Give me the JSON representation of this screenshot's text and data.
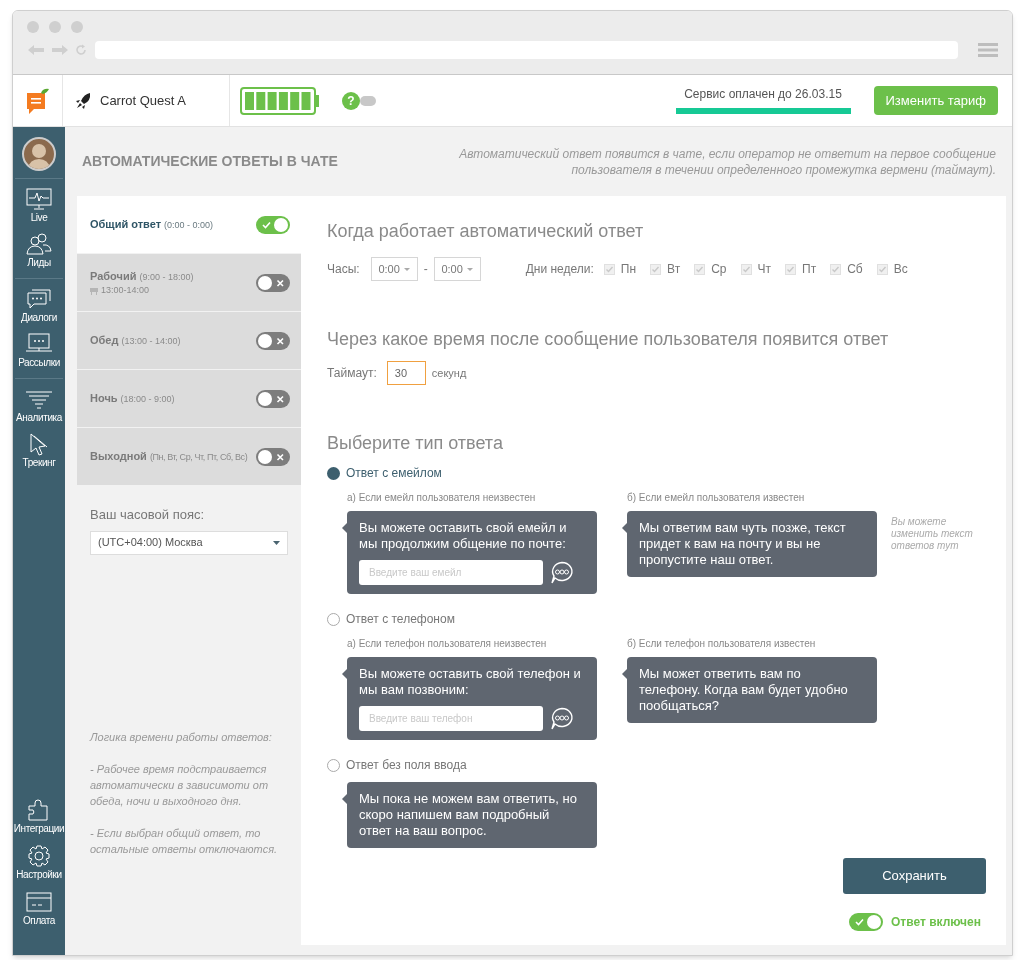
{
  "header": {
    "project": "Carrot Quest A",
    "help": "?",
    "switch_on": false,
    "payment": {
      "text": "Сервис оплачен до 26.03.15"
    },
    "upgrade_button": "Изменить тариф"
  },
  "sidebar": {
    "groups": [
      [
        {
          "label": "Live"
        },
        {
          "label": "Лиды"
        }
      ],
      [
        {
          "label": "Диалоги"
        },
        {
          "label": "Рассылки"
        }
      ],
      [
        {
          "label": "Аналитика"
        },
        {
          "label": "Трекинг"
        }
      ]
    ],
    "bottom": [
      {
        "label": "Интеграции"
      },
      {
        "label": "Настройки"
      },
      {
        "label": "Оплата"
      }
    ]
  },
  "page": {
    "title": "АВТОМАТИЧЕСКИЕ ОТВЕТЫ В ЧАТЕ",
    "description": "Автоматический ответ появится в чате, если оператор не ответит на первое сообщение пользователя в течении определенного промежутка вермени (таймаут)."
  },
  "schedules": [
    {
      "name": "Общий ответ",
      "hours": "(0:00 - 0:00)",
      "selected": true,
      "on": true
    },
    {
      "name": "Рабочий",
      "hours": "(9:00 - 18:00)",
      "note": "13:00-14:00",
      "selected": false,
      "on": false
    },
    {
      "name": "Обед",
      "hours": "(13:00 - 14:00)",
      "selected": false,
      "on": false
    },
    {
      "name": "Ночь",
      "hours": "(18:00 - 9:00)",
      "selected": false,
      "on": false
    },
    {
      "name": "Выходной",
      "hours": "(Пн, Вт, Ср, Чт, Пт, Сб, Вс)",
      "selected": false,
      "on": false
    }
  ],
  "timezone": {
    "label": "Ваш часовой пояс:",
    "value": "(UTC+04:00) Москва"
  },
  "logic_note": [
    "Логика времени работы ответов:",
    "- Рабочее время подстраивается автоматически в зависимоти от обеда, ночи и выходного дня.",
    "- Если выбран общий ответ, то остальные ответы отключаются."
  ],
  "when": {
    "title": "Когда работает автоматический ответ",
    "hours_label": "Часы:",
    "from": "0:00",
    "separator": "-",
    "to": "0:00",
    "days_label": "Дни недели:",
    "days": [
      {
        "label": "Пн",
        "checked": true
      },
      {
        "label": "Вт",
        "checked": true
      },
      {
        "label": "Ср",
        "checked": true
      },
      {
        "label": "Чт",
        "checked": true
      },
      {
        "label": "Пт",
        "checked": true
      },
      {
        "label": "Сб",
        "checked": true
      },
      {
        "label": "Вс",
        "checked": true
      }
    ]
  },
  "timeout": {
    "title": "Через какое время после сообщение пользователя появится ответ",
    "label": "Таймаут:",
    "value": "30",
    "unit": "секунд"
  },
  "reply_type": {
    "title": "Выберите тип ответа",
    "side_note": "Вы можете изменить текст ответов тут",
    "options": [
      {
        "label": "Ответ с емейлом",
        "selected": true,
        "cases": [
          {
            "caption": "а) Если емейл пользователя неизвестен",
            "message": "Вы можете оставить свой емейл и мы продолжим общение по почте:",
            "placeholder": "Введите ваш емейл"
          },
          {
            "caption": "б) Если емейл пользователя известен",
            "message": "Мы ответим вам чуть позже, текст придет к вам на почту и вы не пропустите наш ответ."
          }
        ]
      },
      {
        "label": "Ответ с телефоном",
        "selected": false,
        "cases": [
          {
            "caption": "а) Если телефон пользователя неизвестен",
            "message": "Вы можете оставить свой телефон и мы вам позвоним:",
            "placeholder": "Введите ваш телефон"
          },
          {
            "caption": "б) Если телефон пользователя известен",
            "message": "Мы может ответить вам по телефону. Когда вам будет удобно пообщаться?"
          }
        ]
      },
      {
        "label": "Ответ без поля ввода",
        "selected": false,
        "cases": [
          {
            "message": "Мы пока не можем вам ответить, но скоро напишем вам подробный ответ на ваш вопрос."
          }
        ]
      }
    ]
  },
  "save_button": "Сохранить",
  "enabled": {
    "label": "Ответ включен",
    "on": true
  }
}
